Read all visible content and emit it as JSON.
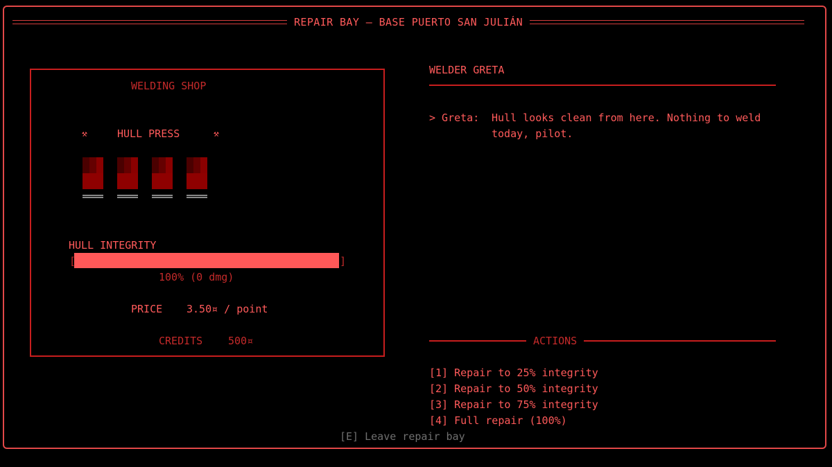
{
  "window": {
    "title": "REPAIR BAY — BASE PUERTO SAN JULIÁN"
  },
  "shop": {
    "title": "WELDING SHOP",
    "machine_label": "HULL PRESS",
    "hammer_glyph": "⚒",
    "hull": {
      "label": "HULL INTEGRITY",
      "bracket_left": "[",
      "bracket_right": "]",
      "integrity_fraction": 1.0,
      "status": "100%  (0 dmg)"
    },
    "price_label": "PRICE",
    "price_value": "3.50¤ / point",
    "credits_label": "CREDITS",
    "credits_value": "500¤"
  },
  "npc": {
    "name": "WELDER GRETA",
    "dialogue_prefix": "> Greta:",
    "dialogue_line1": "Hull looks clean from here. Nothing to weld",
    "dialogue_line2": "today, pilot."
  },
  "actions": {
    "header": "ACTIONS",
    "items": [
      {
        "key": "[1]",
        "label": "Repair to 25% integrity"
      },
      {
        "key": "[2]",
        "label": "Repair to 50% integrity"
      },
      {
        "key": "[3]",
        "label": "Repair to 75% integrity"
      },
      {
        "key": "[4]",
        "label": "Full repair (100%)"
      }
    ]
  },
  "footer": {
    "leave": "[E] Leave repair bay"
  },
  "colors": {
    "accent": "#ff5a5a",
    "dim": "#c42a2a",
    "frame": "#e24848",
    "bar": "#ff5858",
    "muted": "#6f6f6f",
    "background": "#000000"
  }
}
